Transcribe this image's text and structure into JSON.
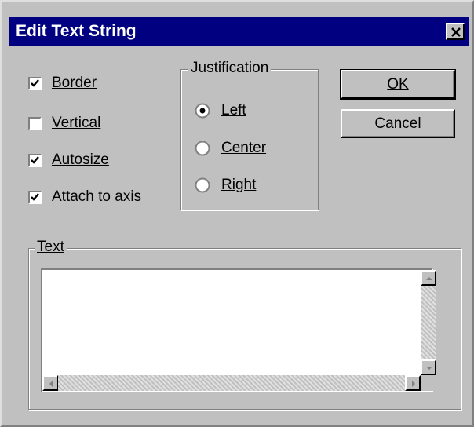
{
  "dialog": {
    "title": "Edit Text String",
    "close_icon": "close-x-icon"
  },
  "options": {
    "border": {
      "label": "Border",
      "checked": true
    },
    "vertical": {
      "label": "Vertical",
      "checked": false
    },
    "autosize": {
      "label": "Autosize",
      "checked": true
    },
    "attach": {
      "label": "Attach to axis",
      "checked": true
    }
  },
  "justification": {
    "legend": "Justification",
    "left": {
      "label": "Left",
      "selected": true
    },
    "center": {
      "label": "Center",
      "selected": false
    },
    "right": {
      "label": "Right",
      "selected": false
    }
  },
  "buttons": {
    "ok": "OK",
    "cancel": "Cancel"
  },
  "text_group": {
    "legend": "Text",
    "value": ""
  },
  "icons": {
    "checkmark": "checkmark-icon",
    "scroll_up": "arrow-up-icon",
    "scroll_down": "arrow-down-icon",
    "scroll_left": "arrow-left-icon",
    "scroll_right": "arrow-right-icon"
  },
  "colors": {
    "face": "#c0c0c0",
    "titlebar": "#000080",
    "title_text": "#ffffff"
  }
}
